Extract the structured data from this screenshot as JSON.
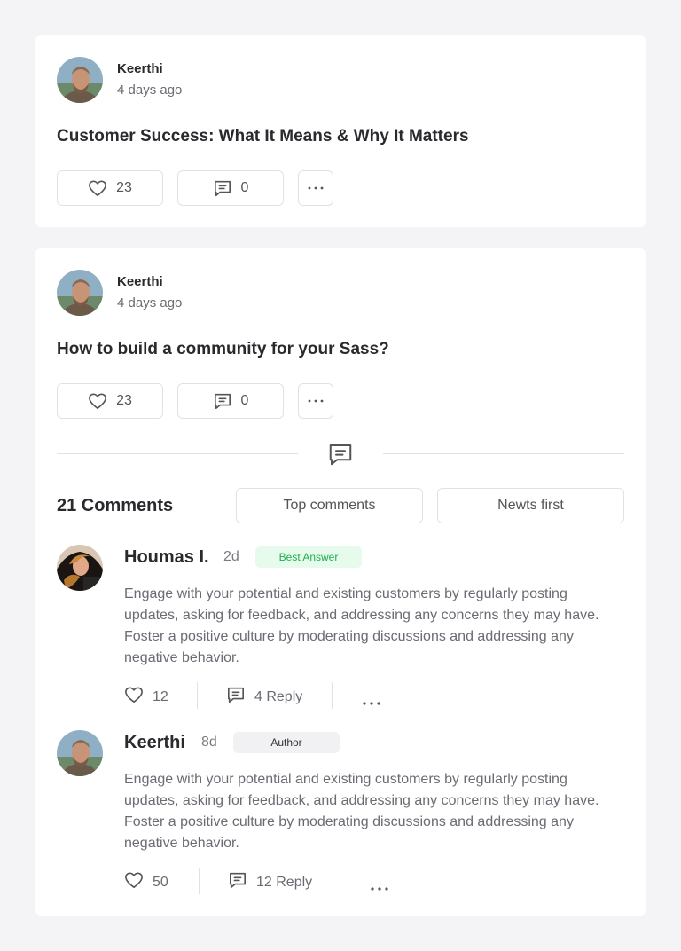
{
  "posts": [
    {
      "author": "Keerthi",
      "time": "4 days ago",
      "title": "Customer Success: What It Means & Why It Matters",
      "likes": "23",
      "comments": "0"
    },
    {
      "author": "Keerthi",
      "time": "4 days ago",
      "title": "How to build a community for your Sass?",
      "likes": "23",
      "comments": "0"
    }
  ],
  "thread": {
    "count_label": "21 Comments",
    "sort_top": "Top comments",
    "sort_newest": "Newts first",
    "comments": [
      {
        "name": "Houmas I.",
        "age": "2d",
        "badge": "Best Answer",
        "body": "Engage with your potential and existing customers by regularly posting updates, asking for feedback, and addressing any concerns they may have. Foster a positive culture by moderating discussions and addressing any negative behavior.",
        "likes": "12",
        "replies": "4 Reply"
      },
      {
        "name": "Keerthi",
        "age": "8d",
        "badge": "Author",
        "body": "Engage with your potential and existing customers by regularly posting updates, asking for feedback, and addressing any concerns they may have. Foster a positive culture by moderating discussions and addressing any negative behavior.",
        "likes": "50",
        "replies": "12 Reply"
      }
    ]
  },
  "icons": {
    "like": "heart-icon",
    "comment": "comment-icon",
    "more": "more-dots-icon"
  },
  "colors": {
    "background": "#f4f4f6",
    "card": "#ffffff",
    "best_answer_bg": "#e6fbec",
    "best_answer_text": "#1fae4f"
  }
}
